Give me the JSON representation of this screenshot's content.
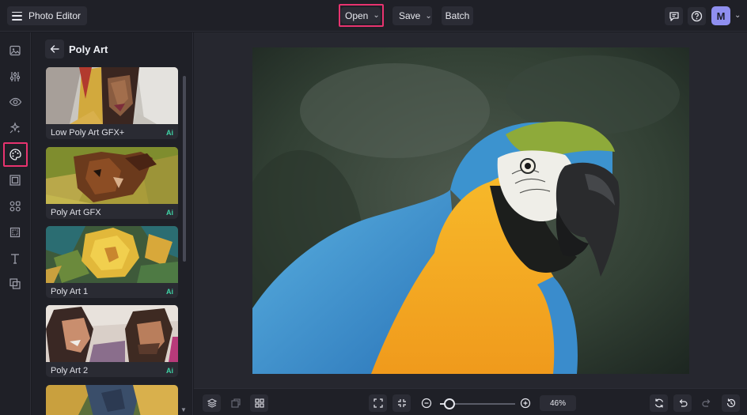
{
  "header": {
    "app_title": "Photo Editor",
    "open_label": "Open",
    "save_label": "Save",
    "batch_label": "Batch",
    "avatar_initial": "M",
    "highlight_color": "#e8336f",
    "avatar_color": "#8f8ff0"
  },
  "rail": {
    "items": [
      "image-icon",
      "adjust-sliders-icon",
      "eye-icon",
      "sparkle-effects-icon",
      "artsy-palette-icon",
      "frame-icon",
      "graphics-icon",
      "texture-icon",
      "text-icon",
      "overlay-icon"
    ],
    "active": "artsy-palette-icon"
  },
  "panel": {
    "title": "Poly Art",
    "cards": [
      {
        "label": "Low Poly Art GFX+",
        "badge": "Ai"
      },
      {
        "label": "Poly Art GFX",
        "badge": "Ai"
      },
      {
        "label": "Poly Art 1",
        "badge": "Ai"
      },
      {
        "label": "Poly Art 2",
        "badge": "Ai"
      }
    ],
    "ai_badge_color": "#3fd3a6"
  },
  "bottom": {
    "zoom_label": "46%",
    "zoom_value": 0.46
  }
}
